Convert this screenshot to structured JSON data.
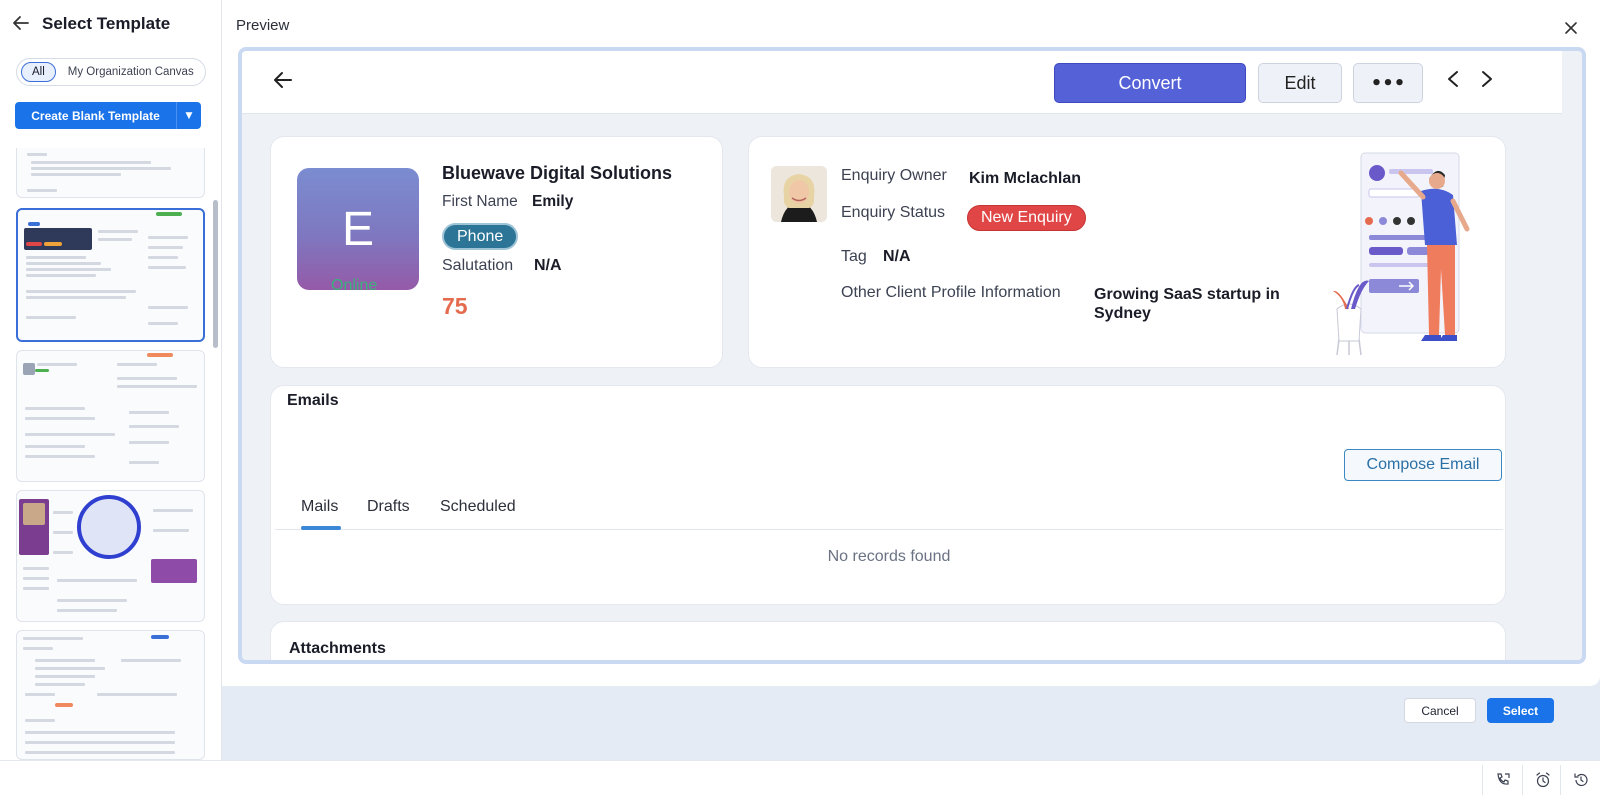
{
  "left_panel": {
    "title": "Select Template",
    "filters": [
      "All",
      "My Organization Canvas"
    ],
    "create_button": "Create Blank Template"
  },
  "preview": {
    "label": "Preview",
    "toolbar": {
      "convert": "Convert",
      "edit": "Edit",
      "more": "•••"
    },
    "profile_card": {
      "avatar_letter": "E",
      "presence": "Online",
      "company": "Bluewave Digital Solutions",
      "first_name_label": "First Name",
      "first_name_value": "Emily",
      "phone_badge": "Phone",
      "salutation_label": "Salutation",
      "salutation_value": "N/A",
      "score": "75"
    },
    "enquiry_card": {
      "owner_label": "Enquiry Owner",
      "owner_value": "Kim Mclachlan",
      "status_label": "Enquiry Status",
      "status_value": "New Enquiry",
      "tag_label": "Tag",
      "tag_value": "N/A",
      "profile_label": "Other Client Profile Information",
      "profile_value": "Growing SaaS startup in Sydney"
    },
    "emails": {
      "title": "Emails",
      "compose": "Compose Email",
      "tabs": [
        "Mails",
        "Drafts",
        "Scheduled"
      ],
      "empty": "No records found"
    },
    "attachments": {
      "title": "Attachments"
    }
  },
  "footer": {
    "cancel": "Cancel",
    "select": "Select"
  },
  "colors": {
    "primary": "#1a73e8",
    "convert": "#5561d6",
    "status_red": "#e04646",
    "phone_pill": "#2c7596",
    "score": "#e56b4e",
    "online": "#3bb07a"
  }
}
